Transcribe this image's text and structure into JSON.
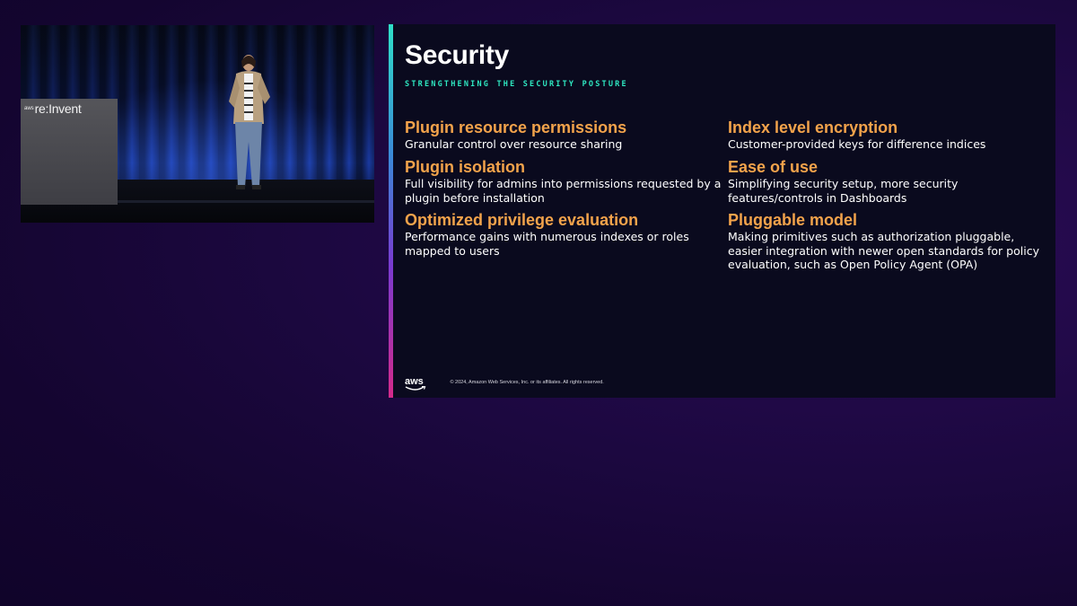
{
  "video": {
    "podium_logo_small": "aws",
    "podium_logo": "re:Invent"
  },
  "slide": {
    "title": "Security",
    "subtitle": "STRENGTHENING THE SECURITY POSTURE",
    "items": [
      {
        "heading": "Plugin resource permissions",
        "description": "Granular control over resource sharing"
      },
      {
        "heading": "Index level encryption",
        "description": "Customer-provided keys for difference indices"
      },
      {
        "heading": "Plugin isolation",
        "description": "Full visibility for admins into permissions requested by a plugin before installation"
      },
      {
        "heading": "Ease of use",
        "description": "Simplifying security setup, more security features/controls in Dashboards"
      },
      {
        "heading": "Optimized privilege evaluation",
        "description": "Performance gains with numerous indexes or roles mapped to users"
      },
      {
        "heading": "Pluggable model",
        "description": "Making primitives such as authorization pluggable, easier integration with newer open standards for policy evaluation, such as Open Policy Agent (OPA)"
      }
    ],
    "footer": {
      "logo_text": "aws",
      "copyright": "© 2024, Amazon Web Services, Inc. or its affiliates. All rights reserved."
    }
  },
  "colors": {
    "heading": "#f3a34b",
    "subtitle": "#2ee6c0",
    "background": "#1c0840"
  }
}
